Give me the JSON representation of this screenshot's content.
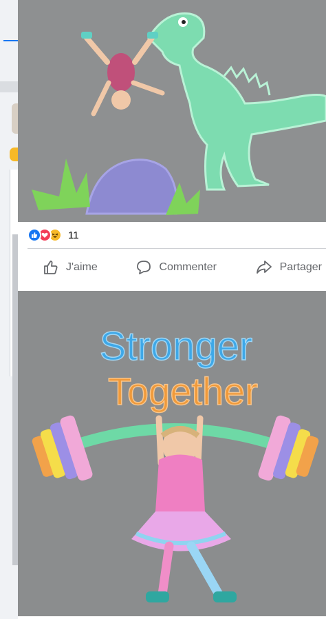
{
  "post": {
    "reactions": {
      "types": [
        "like",
        "love",
        "haha"
      ],
      "count": "11",
      "colors": {
        "like": "#1877f2",
        "love": "#f33e58",
        "haha": "#f7b928"
      }
    },
    "actions": {
      "like_label": "J'aime",
      "comment_label": "Commenter",
      "share_label": "Partager"
    },
    "images": [
      {
        "subject": "chalk drawing of a green dinosaur with a child lying on pavement"
      },
      {
        "subject": "chalk drawing of a rainbow barbell with a girl lying on pavement"
      }
    ],
    "second_image_text": {
      "line1": "Stronger",
      "line2": "Together"
    }
  },
  "icons": {
    "like": "thumbs-up-icon",
    "comment": "comment-bubble-icon",
    "share": "share-arrow-icon"
  }
}
